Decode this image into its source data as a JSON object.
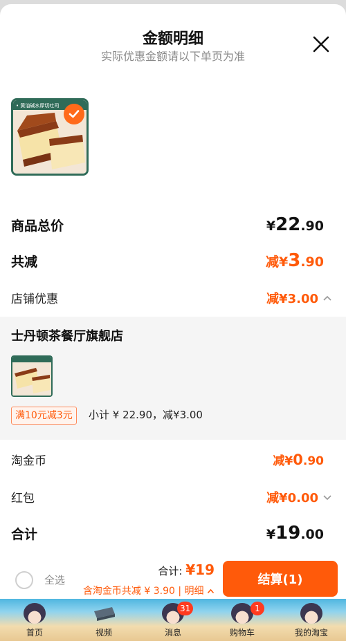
{
  "header": {
    "title": "金额明细",
    "subtitle": "实际优惠金额请以下单页为准"
  },
  "product": {
    "image_caption": "• 黄油碱水厚切吐司",
    "selected": true
  },
  "summary": {
    "total_label": "商品总价",
    "total_currency": "¥",
    "total_int": "22",
    "total_dec": ".90",
    "reduce_label": "共减",
    "reduce_prefix": "减¥",
    "reduce_int": "3",
    "reduce_dec": ".90"
  },
  "store_discount": {
    "label": "店铺优惠",
    "value": "减¥3.00",
    "shop_name": "士丹顿茶餐厅旗舰店",
    "promo_tag": "满10元减3元",
    "subtotal": "小计 ¥ 22.90，减¥3.00"
  },
  "taojinbi": {
    "label": "淘金币",
    "prefix": "减¥",
    "int": "0",
    "dec": ".90"
  },
  "hongbao": {
    "label": "红包",
    "value": "减¥0.00"
  },
  "final": {
    "label": "合计",
    "currency": "¥",
    "int": "19",
    "dec": ".00"
  },
  "bottom_bar": {
    "select_all": "全选",
    "total_label": "合计: ",
    "total_value": "¥19",
    "discount_note": "含淘金币共减 ¥ 3.90 | 明细",
    "checkout": "结算(1)"
  },
  "tabs": [
    {
      "label": "首页",
      "badge": ""
    },
    {
      "label": "视频",
      "badge": ""
    },
    {
      "label": "消息",
      "badge": "31"
    },
    {
      "label": "购物车",
      "badge": "1"
    },
    {
      "label": "我的淘宝",
      "badge": ""
    }
  ],
  "colors": {
    "accent": "#ff5a0a",
    "thumb_border": "#2f6b58"
  }
}
